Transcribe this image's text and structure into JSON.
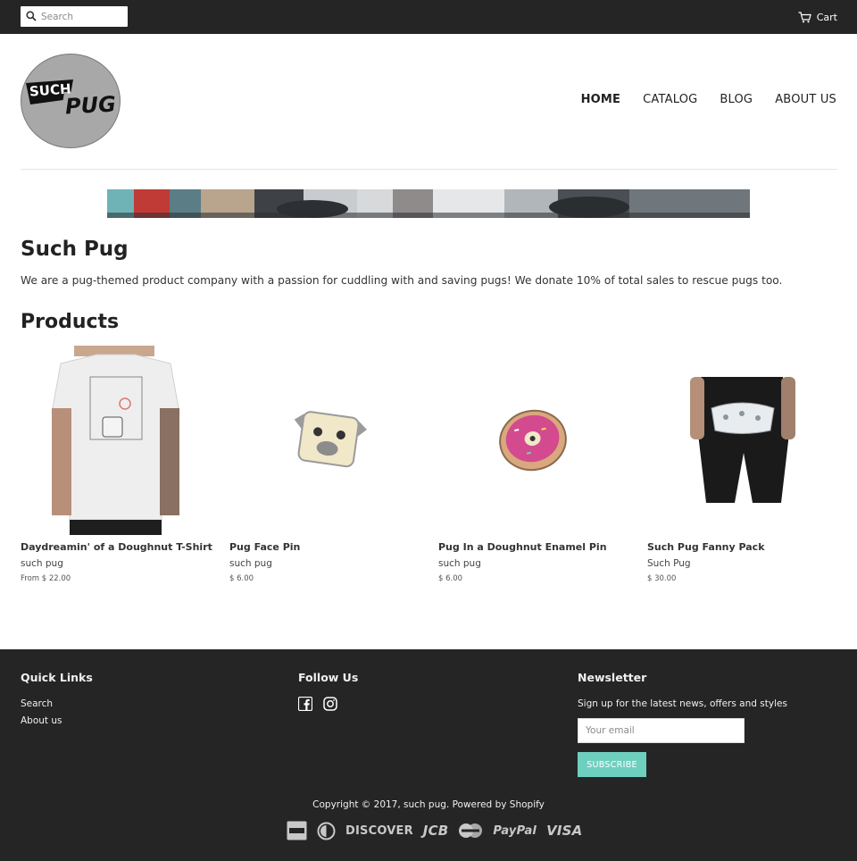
{
  "topbar": {
    "search_placeholder": "Search",
    "cart_label": "Cart"
  },
  "header": {
    "logo_text_top": "SUCH",
    "logo_text_bottom": "PUG",
    "nav": [
      {
        "label": "HOME",
        "active": true
      },
      {
        "label": "CATALOG",
        "active": false
      },
      {
        "label": "BLOG",
        "active": false
      },
      {
        "label": "ABOUT US",
        "active": false
      }
    ]
  },
  "intro": {
    "title": "Such Pug",
    "description": "We are a pug-themed product company with a passion for cuddling with and saving pugs! We donate 10% of total sales to rescue pugs too."
  },
  "products": {
    "title": "Products",
    "items": [
      {
        "name": "Daydreamin' of a Doughnut T-Shirt",
        "vendor": "such pug",
        "price": "From $ 22.00"
      },
      {
        "name": "Pug Face Pin",
        "vendor": "such pug",
        "price": "$ 6.00"
      },
      {
        "name": "Pug In a Doughnut Enamel Pin",
        "vendor": "such pug",
        "price": "$ 6.00"
      },
      {
        "name": "Such Pug Fanny Pack",
        "vendor": "Such Pug",
        "price": "$ 30.00"
      }
    ]
  },
  "footer": {
    "quick_links_title": "Quick Links",
    "quick_links": [
      "Search",
      "About us"
    ],
    "follow_title": "Follow Us",
    "social_icons": [
      "facebook-icon",
      "instagram-icon"
    ],
    "newsletter_title": "Newsletter",
    "newsletter_text": "Sign up for the latest news, offers and styles",
    "email_placeholder": "Your email",
    "subscribe_label": "SUBSCRIBE",
    "copyright": "Copyright © 2017, such pug. Powered by Shopify",
    "payments": {
      "discover": "DISCOVER",
      "jcb": "JCB",
      "paypal": "PayPal",
      "visa": "VISA"
    }
  },
  "colors": {
    "bar_background": "#252525",
    "subscribe_accent": "#6fcfbf"
  }
}
